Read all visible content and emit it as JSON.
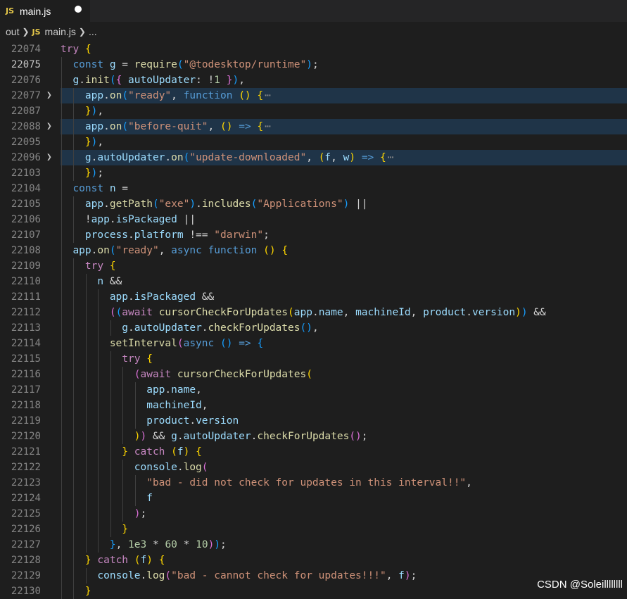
{
  "tab": {
    "icon_text": "JS",
    "filename": "main.js",
    "status_icon": "unsaved-dot-icon"
  },
  "breadcrumb": {
    "folder": "out",
    "file_icon_text": "JS",
    "file": "main.js",
    "trail": "..."
  },
  "colors": {
    "keyword": "#c586c0",
    "storage": "#569cd6",
    "variable": "#9cdcfe",
    "function": "#dcdcaa",
    "string": "#ce9178",
    "number": "#b5cea8",
    "plain": "#d4d4d4",
    "brace": "#da70d6",
    "paren": "#179fff",
    "bracket_gold": "#ffd700"
  },
  "lines": [
    {
      "n": "22074",
      "indent": 0,
      "tokens": [
        [
          "kw",
          "try"
        ],
        [
          "p",
          " "
        ],
        [
          "bg",
          "{"
        ]
      ]
    },
    {
      "n": "22075",
      "indent": 1,
      "tokens": [
        [
          "st",
          "const"
        ],
        [
          "p",
          " "
        ],
        [
          "v",
          "g"
        ],
        [
          "p",
          " = "
        ],
        [
          "fn",
          "require"
        ],
        [
          "bb",
          "("
        ],
        [
          "s",
          "\"@todesktop/runtime\""
        ],
        [
          "bb",
          ")"
        ],
        [
          "p",
          ";"
        ]
      ]
    },
    {
      "n": "22076",
      "indent": 1,
      "tokens": [
        [
          "v",
          "g"
        ],
        [
          "p",
          "."
        ],
        [
          "fn",
          "init"
        ],
        [
          "bb",
          "("
        ],
        [
          "bp",
          "{"
        ],
        [
          "p",
          " "
        ],
        [
          "v",
          "autoUpdater"
        ],
        [
          "p",
          ": !"
        ],
        [
          "nu",
          "1"
        ],
        [
          "p",
          " "
        ],
        [
          "bp",
          "}"
        ],
        [
          "bb",
          ")"
        ],
        [
          "p",
          ","
        ]
      ]
    },
    {
      "n": "22077",
      "indent": 2,
      "fold": true,
      "tokens": [
        [
          "v",
          "app"
        ],
        [
          "p",
          "."
        ],
        [
          "fn",
          "on"
        ],
        [
          "bb",
          "("
        ],
        [
          "s",
          "\"ready\""
        ],
        [
          "p",
          ", "
        ],
        [
          "st",
          "function"
        ],
        [
          "p",
          " "
        ],
        [
          "bg",
          "()"
        ],
        [
          "p",
          " "
        ],
        [
          "bg",
          "{"
        ],
        [
          "el",
          "⋯"
        ]
      ]
    },
    {
      "n": "22087",
      "indent": 2,
      "tokens": [
        [
          "bg",
          "}"
        ],
        [
          "bb",
          ")"
        ],
        [
          "p",
          ","
        ]
      ]
    },
    {
      "n": "22088",
      "indent": 2,
      "fold": true,
      "tokens": [
        [
          "v",
          "app"
        ],
        [
          "p",
          "."
        ],
        [
          "fn",
          "on"
        ],
        [
          "bb",
          "("
        ],
        [
          "s",
          "\"before-quit\""
        ],
        [
          "p",
          ", "
        ],
        [
          "bg",
          "()"
        ],
        [
          "p",
          " "
        ],
        [
          "st",
          "=>"
        ],
        [
          "p",
          " "
        ],
        [
          "bg",
          "{"
        ],
        [
          "el",
          "⋯"
        ]
      ]
    },
    {
      "n": "22095",
      "indent": 2,
      "tokens": [
        [
          "bg",
          "}"
        ],
        [
          "bb",
          ")"
        ],
        [
          "p",
          ","
        ]
      ]
    },
    {
      "n": "22096",
      "indent": 2,
      "fold": true,
      "tokens": [
        [
          "v",
          "g"
        ],
        [
          "p",
          "."
        ],
        [
          "v",
          "autoUpdater"
        ],
        [
          "p",
          "."
        ],
        [
          "fn",
          "on"
        ],
        [
          "bb",
          "("
        ],
        [
          "s",
          "\"update-downloaded\""
        ],
        [
          "p",
          ", "
        ],
        [
          "bg",
          "("
        ],
        [
          "v",
          "f"
        ],
        [
          "p",
          ", "
        ],
        [
          "v",
          "w"
        ],
        [
          "bg",
          ")"
        ],
        [
          "p",
          " "
        ],
        [
          "st",
          "=>"
        ],
        [
          "p",
          " "
        ],
        [
          "bg",
          "{"
        ],
        [
          "el",
          "⋯"
        ]
      ]
    },
    {
      "n": "22103",
      "indent": 2,
      "tokens": [
        [
          "bg",
          "}"
        ],
        [
          "bb",
          ")"
        ],
        [
          "p",
          ";"
        ]
      ]
    },
    {
      "n": "22104",
      "indent": 1,
      "tokens": [
        [
          "st",
          "const"
        ],
        [
          "p",
          " "
        ],
        [
          "v",
          "n"
        ],
        [
          "p",
          " ="
        ]
      ]
    },
    {
      "n": "22105",
      "indent": 2,
      "tokens": [
        [
          "v",
          "app"
        ],
        [
          "p",
          "."
        ],
        [
          "fn",
          "getPath"
        ],
        [
          "bb",
          "("
        ],
        [
          "s",
          "\"exe\""
        ],
        [
          "bb",
          ")"
        ],
        [
          "p",
          "."
        ],
        [
          "fn",
          "includes"
        ],
        [
          "bb",
          "("
        ],
        [
          "s",
          "\"Applications\""
        ],
        [
          "bb",
          ")"
        ],
        [
          "p",
          " ||"
        ]
      ]
    },
    {
      "n": "22106",
      "indent": 2,
      "tokens": [
        [
          "p",
          "!"
        ],
        [
          "v",
          "app"
        ],
        [
          "p",
          "."
        ],
        [
          "v",
          "isPackaged"
        ],
        [
          "p",
          " ||"
        ]
      ]
    },
    {
      "n": "22107",
      "indent": 2,
      "tokens": [
        [
          "v",
          "process"
        ],
        [
          "p",
          "."
        ],
        [
          "v",
          "platform"
        ],
        [
          "p",
          " !== "
        ],
        [
          "s",
          "\"darwin\""
        ],
        [
          "p",
          ";"
        ]
      ]
    },
    {
      "n": "22108",
      "indent": 1,
      "tokens": [
        [
          "v",
          "app"
        ],
        [
          "p",
          "."
        ],
        [
          "fn",
          "on"
        ],
        [
          "bb",
          "("
        ],
        [
          "s",
          "\"ready\""
        ],
        [
          "p",
          ", "
        ],
        [
          "st",
          "async"
        ],
        [
          "p",
          " "
        ],
        [
          "st",
          "function"
        ],
        [
          "p",
          " "
        ],
        [
          "bg",
          "()"
        ],
        [
          "p",
          " "
        ],
        [
          "bg",
          "{"
        ]
      ]
    },
    {
      "n": "22109",
      "indent": 2,
      "tokens": [
        [
          "kw",
          "try"
        ],
        [
          "p",
          " "
        ],
        [
          "bg",
          "{"
        ]
      ]
    },
    {
      "n": "22110",
      "indent": 3,
      "tokens": [
        [
          "v",
          "n"
        ],
        [
          "p",
          " &&"
        ]
      ]
    },
    {
      "n": "22111",
      "indent": 4,
      "tokens": [
        [
          "v",
          "app"
        ],
        [
          "p",
          "."
        ],
        [
          "v",
          "isPackaged"
        ],
        [
          "p",
          " &&"
        ]
      ]
    },
    {
      "n": "22112",
      "indent": 4,
      "tokens": [
        [
          "bp",
          "("
        ],
        [
          "bb",
          "("
        ],
        [
          "kw",
          "await"
        ],
        [
          "p",
          " "
        ],
        [
          "fn",
          "cursorCheckForUpdates"
        ],
        [
          "bg",
          "("
        ],
        [
          "v",
          "app"
        ],
        [
          "p",
          "."
        ],
        [
          "v",
          "name"
        ],
        [
          "p",
          ", "
        ],
        [
          "v",
          "machineId"
        ],
        [
          "p",
          ", "
        ],
        [
          "v",
          "product"
        ],
        [
          "p",
          "."
        ],
        [
          "v",
          "version"
        ],
        [
          "bg",
          ")"
        ],
        [
          "bb",
          ")"
        ],
        [
          "p",
          " &&"
        ]
      ]
    },
    {
      "n": "22113",
      "indent": 5,
      "tokens": [
        [
          "v",
          "g"
        ],
        [
          "p",
          "."
        ],
        [
          "v",
          "autoUpdater"
        ],
        [
          "p",
          "."
        ],
        [
          "fn",
          "checkForUpdates"
        ],
        [
          "bb",
          "()"
        ],
        [
          "p",
          ","
        ]
      ]
    },
    {
      "n": "22114",
      "indent": 4,
      "tokens": [
        [
          "fn",
          "setInterval"
        ],
        [
          "bp",
          "("
        ],
        [
          "st",
          "async"
        ],
        [
          "p",
          " "
        ],
        [
          "bb",
          "()"
        ],
        [
          "p",
          " "
        ],
        [
          "st",
          "=>"
        ],
        [
          "p",
          " "
        ],
        [
          "bb",
          "{"
        ]
      ]
    },
    {
      "n": "22115",
      "indent": 5,
      "tokens": [
        [
          "kw",
          "try"
        ],
        [
          "p",
          " "
        ],
        [
          "bg",
          "{"
        ]
      ]
    },
    {
      "n": "22116",
      "indent": 6,
      "tokens": [
        [
          "bp",
          "("
        ],
        [
          "kw",
          "await"
        ],
        [
          "p",
          " "
        ],
        [
          "fn",
          "cursorCheckForUpdates"
        ],
        [
          "bg",
          "("
        ]
      ]
    },
    {
      "n": "22117",
      "indent": 7,
      "tokens": [
        [
          "v",
          "app"
        ],
        [
          "p",
          "."
        ],
        [
          "v",
          "name"
        ],
        [
          "p",
          ","
        ]
      ]
    },
    {
      "n": "22118",
      "indent": 7,
      "tokens": [
        [
          "v",
          "machineId"
        ],
        [
          "p",
          ","
        ]
      ]
    },
    {
      "n": "22119",
      "indent": 7,
      "tokens": [
        [
          "v",
          "product"
        ],
        [
          "p",
          "."
        ],
        [
          "v",
          "version"
        ]
      ]
    },
    {
      "n": "22120",
      "indent": 6,
      "tokens": [
        [
          "bg",
          ")"
        ],
        [
          "bp",
          ")"
        ],
        [
          "p",
          " && "
        ],
        [
          "v",
          "g"
        ],
        [
          "p",
          "."
        ],
        [
          "v",
          "autoUpdater"
        ],
        [
          "p",
          "."
        ],
        [
          "fn",
          "checkForUpdates"
        ],
        [
          "bp",
          "()"
        ],
        [
          "p",
          ";"
        ]
      ]
    },
    {
      "n": "22121",
      "indent": 5,
      "tokens": [
        [
          "bg",
          "}"
        ],
        [
          "p",
          " "
        ],
        [
          "kw",
          "catch"
        ],
        [
          "p",
          " "
        ],
        [
          "bg",
          "("
        ],
        [
          "v",
          "f"
        ],
        [
          "bg",
          ")"
        ],
        [
          "p",
          " "
        ],
        [
          "bg",
          "{"
        ]
      ]
    },
    {
      "n": "22122",
      "indent": 6,
      "tokens": [
        [
          "v",
          "console"
        ],
        [
          "p",
          "."
        ],
        [
          "fn",
          "log"
        ],
        [
          "bp",
          "("
        ]
      ]
    },
    {
      "n": "22123",
      "indent": 7,
      "tokens": [
        [
          "s",
          "\"bad - did not check for updates in this interval!!\""
        ],
        [
          "p",
          ","
        ]
      ]
    },
    {
      "n": "22124",
      "indent": 7,
      "tokens": [
        [
          "v",
          "f"
        ]
      ]
    },
    {
      "n": "22125",
      "indent": 6,
      "tokens": [
        [
          "bp",
          ")"
        ],
        [
          "p",
          ";"
        ]
      ]
    },
    {
      "n": "22126",
      "indent": 5,
      "tokens": [
        [
          "bg",
          "}"
        ]
      ]
    },
    {
      "n": "22127",
      "indent": 4,
      "tokens": [
        [
          "bb",
          "}"
        ],
        [
          "p",
          ", "
        ],
        [
          "nu",
          "1e3"
        ],
        [
          "p",
          " * "
        ],
        [
          "nu",
          "60"
        ],
        [
          "p",
          " * "
        ],
        [
          "nu",
          "10"
        ],
        [
          "bp",
          ")"
        ],
        [
          "bb",
          ")"
        ],
        [
          "p",
          ";"
        ]
      ]
    },
    {
      "n": "22128",
      "indent": 2,
      "tokens": [
        [
          "bg",
          "}"
        ],
        [
          "p",
          " "
        ],
        [
          "kw",
          "catch"
        ],
        [
          "p",
          " "
        ],
        [
          "bg",
          "("
        ],
        [
          "v",
          "f"
        ],
        [
          "bg",
          ")"
        ],
        [
          "p",
          " "
        ],
        [
          "bg",
          "{"
        ]
      ]
    },
    {
      "n": "22129",
      "indent": 3,
      "tokens": [
        [
          "v",
          "console"
        ],
        [
          "p",
          "."
        ],
        [
          "fn",
          "log"
        ],
        [
          "bp",
          "("
        ],
        [
          "s",
          "\"bad - cannot check for updates!!!\""
        ],
        [
          "p",
          ", "
        ],
        [
          "v",
          "f"
        ],
        [
          "bp",
          ")"
        ],
        [
          "p",
          ";"
        ]
      ]
    },
    {
      "n": "22130",
      "indent": 2,
      "tokens": [
        [
          "bg",
          "}"
        ]
      ]
    }
  ],
  "active_line": "22075",
  "watermark": "CSDN @Soleillllllll"
}
